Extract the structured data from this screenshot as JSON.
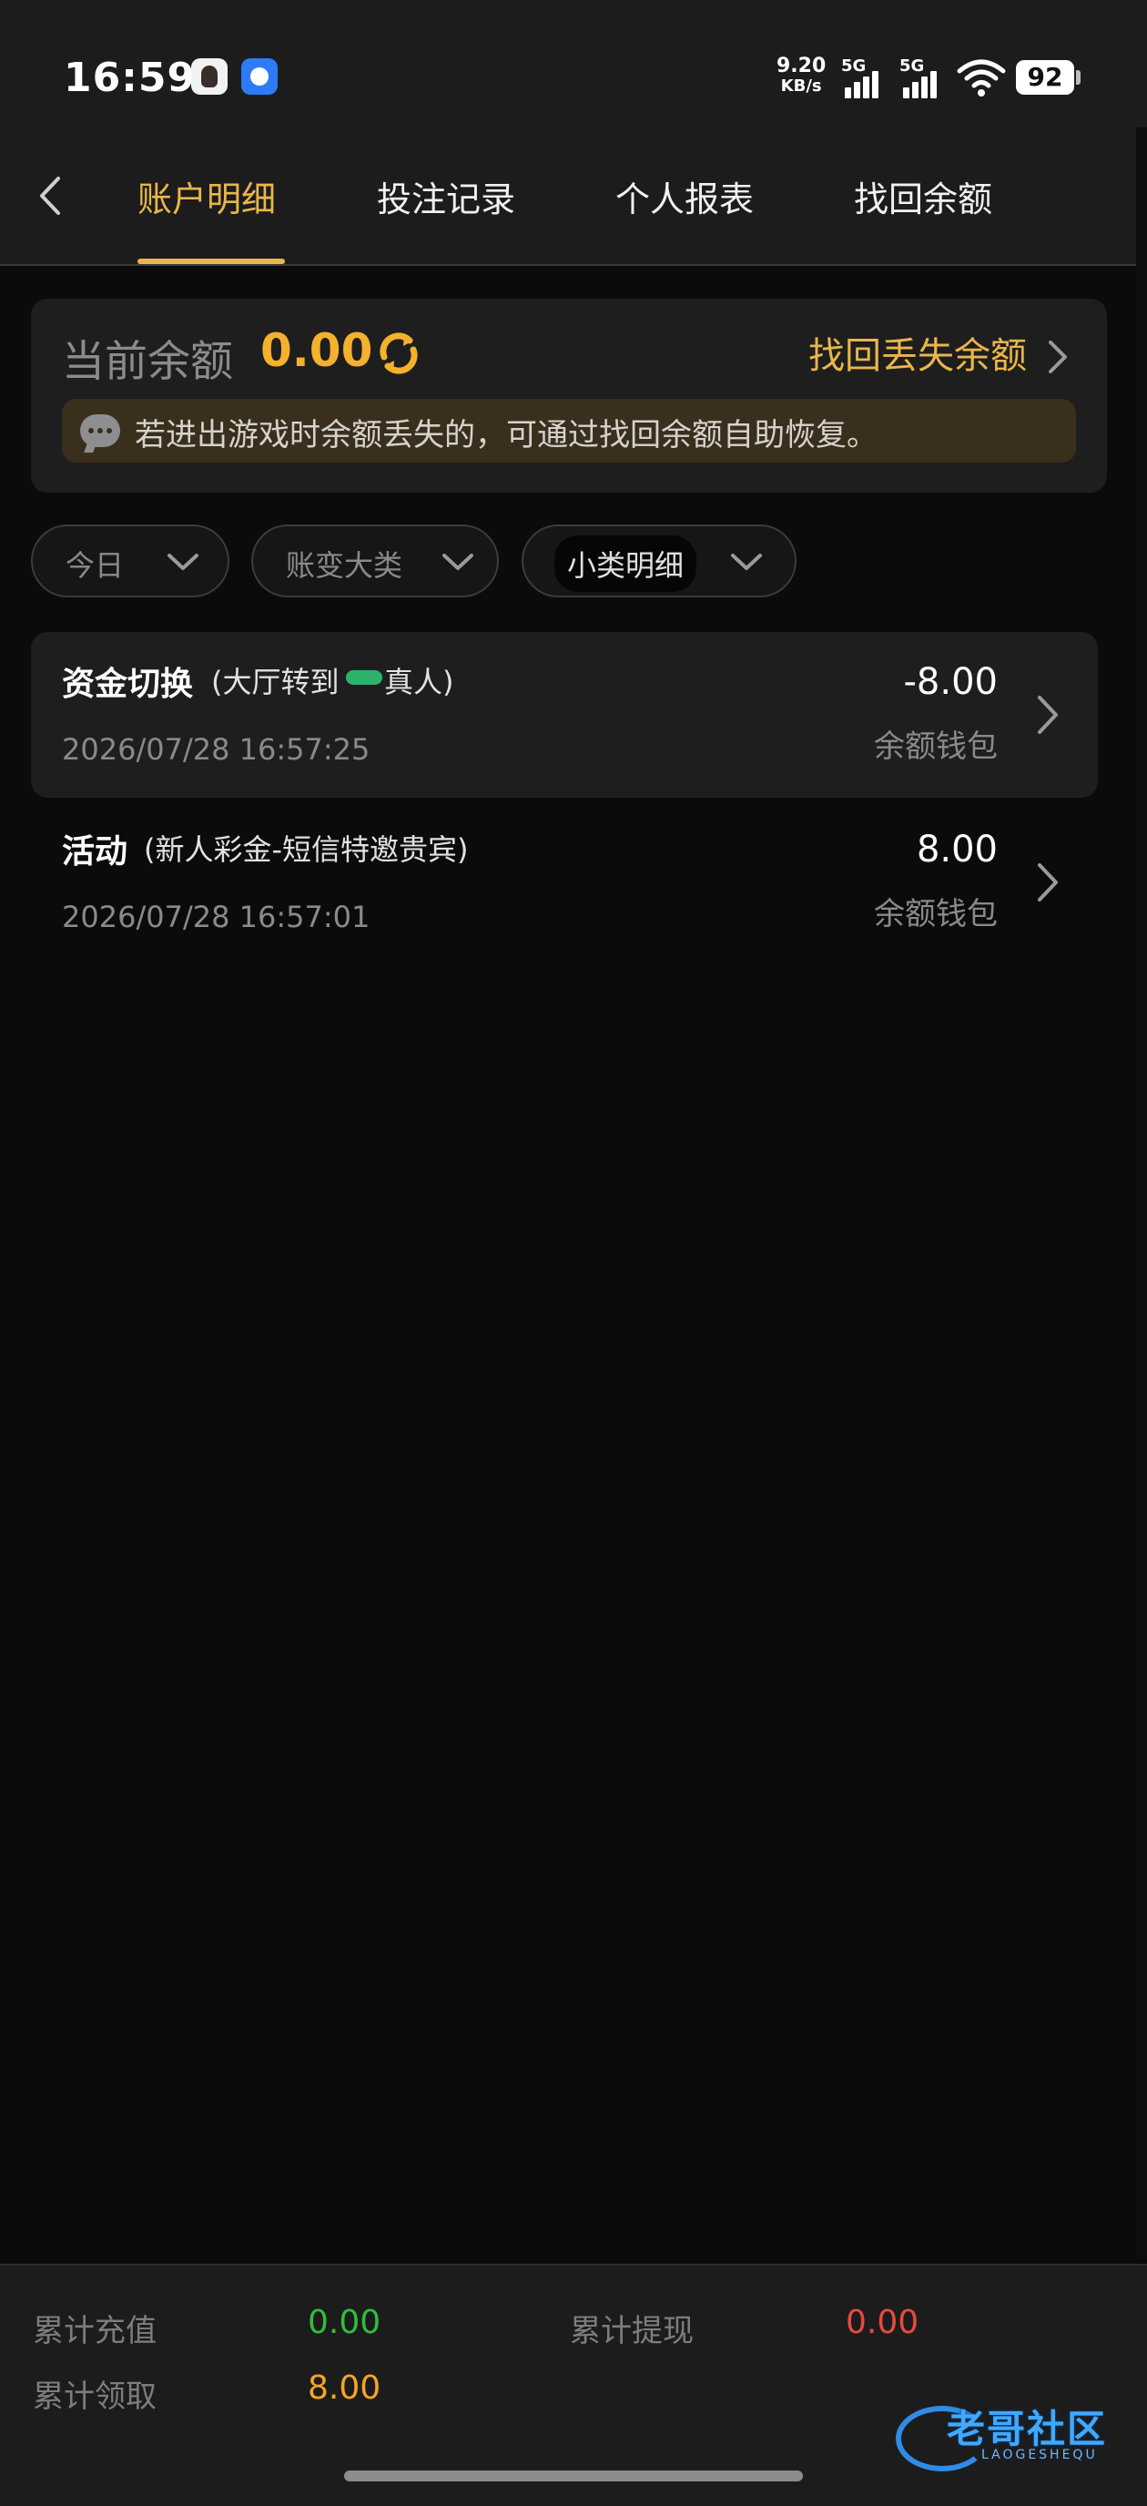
{
  "status_bar": {
    "time": "16:59",
    "net_speed": "9.20",
    "net_unit": "KB/s",
    "signal1_label": "5G",
    "signal2_label": "5G",
    "battery": "92"
  },
  "nav": {
    "back_icon": "chevron-left-icon",
    "tabs": [
      {
        "label": "账户明细",
        "active": true
      },
      {
        "label": "投注记录",
        "active": false
      },
      {
        "label": "个人报表",
        "active": false
      },
      {
        "label": "找回余额",
        "active": false
      }
    ]
  },
  "balance": {
    "label": "当前余额",
    "value": "0.00",
    "recover_link": "找回丢失余额",
    "notice": "若进出游戏时余额丢失的，可通过找回余额自助恢复。"
  },
  "filters": [
    {
      "label": "今日",
      "selected": false
    },
    {
      "label": "账变大类",
      "selected": false
    },
    {
      "label": "小类明细",
      "selected": true
    }
  ],
  "records": [
    {
      "title": "资金切换",
      "sub_before": "(大厅转到",
      "sub_after": "真人)",
      "time": "2026/07/28 16:57:25",
      "amount": "-8.00",
      "wallet": "余额钱包"
    },
    {
      "title": "活动",
      "sub_before": "(新人彩金-短信特邀贵宾)",
      "sub_after": "",
      "time": "2026/07/28 16:57:01",
      "amount": "8.00",
      "wallet": "余额钱包"
    }
  ],
  "summary": {
    "recharge_label": "累计充值",
    "recharge_value": "0.00",
    "withdraw_label": "累计提现",
    "withdraw_value": "0.00",
    "claim_label": "累计领取",
    "claim_value": "8.00"
  },
  "colors": {
    "accent": "#e8b64a",
    "balance": "#f3b12c",
    "green": "#2fbf3a",
    "red": "#e84a3c",
    "orange": "#f5a623"
  },
  "watermark": {
    "text": "老哥社区",
    "sub": "LAOGESHEQU"
  }
}
